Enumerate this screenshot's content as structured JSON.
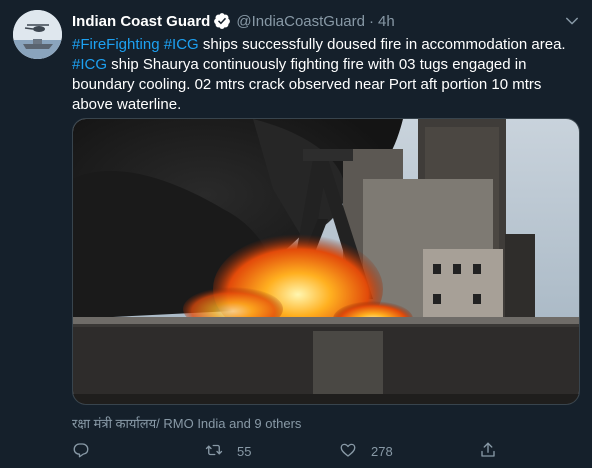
{
  "tweet": {
    "author_name": "Indian Coast Guard",
    "handle": "@IndiaCoastGuard",
    "separator": "·",
    "time": "4h",
    "text_segments": [
      {
        "text": "#FireFighting",
        "hashtag": true
      },
      {
        "text": " ",
        "hashtag": false
      },
      {
        "text": "#ICG",
        "hashtag": true
      },
      {
        "text": " ships successfully doused fire in accommodation area. ",
        "hashtag": false
      },
      {
        "text": "#ICG",
        "hashtag": true
      },
      {
        "text": " ship Shaurya continuously fighting fire with 03 tugs engaged in boundary cooling. 02 mtrs crack observed near Port aft portion 10 mtrs above waterline.",
        "hashtag": false
      }
    ],
    "liked_by": "रक्षा मंत्री कार्यालय/ RMO India and 9 others",
    "actions": {
      "reply_count": "",
      "retweet_count": "55",
      "like_count": "278"
    }
  },
  "colors": {
    "background": "#15202b",
    "hashtag": "#1da1f2",
    "muted": "#8899a6",
    "verified": "#ffffff"
  },
  "icons": [
    "avatar-helicopter-ship",
    "verified-badge-icon",
    "chevron-down-icon",
    "reply-icon",
    "retweet-icon",
    "like-icon",
    "share-icon"
  ]
}
